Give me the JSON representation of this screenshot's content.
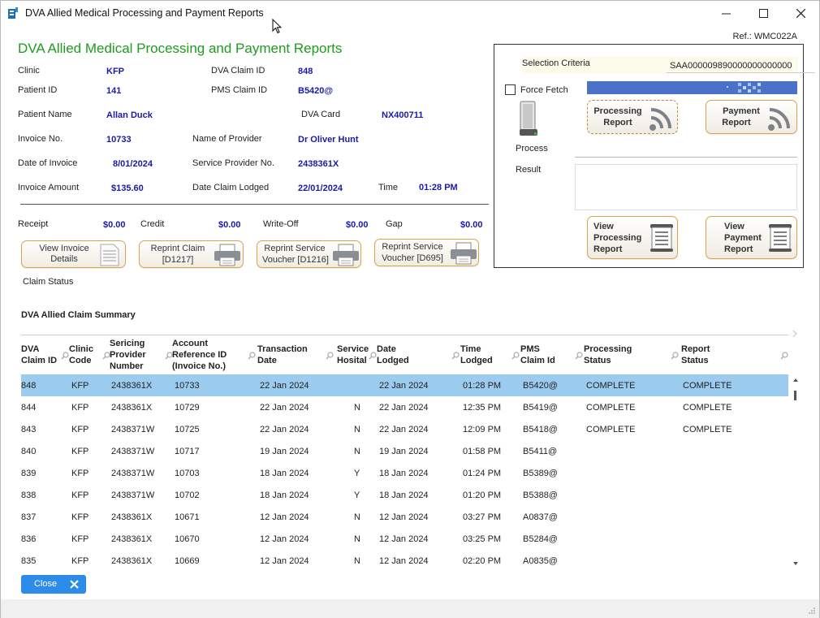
{
  "window": {
    "title": "DVA  Allied Medical Processing and Payment Reports"
  },
  "ref": "Ref.: WMC022A",
  "heading": "DVA  Allied Medical Processing and Payment Reports",
  "fields": {
    "clinic": {
      "label": "Clinic",
      "value": "KFP"
    },
    "dva_claim_id": {
      "label": "DVA Claim ID",
      "value": "848"
    },
    "patient_id": {
      "label": "Patient ID",
      "value": "141"
    },
    "pms_claim_id": {
      "label": "PMS Claim ID",
      "value": "B5420@"
    },
    "patient_name": {
      "label": "Patient Name",
      "value": "Allan  Duck"
    },
    "dva_card": {
      "label": "DVA Card",
      "value": "NX400711"
    },
    "invoice_no": {
      "label": "Invoice No.",
      "value": "10733"
    },
    "provider_name": {
      "label": "Name of Provider",
      "value": "Dr Oliver Hunt"
    },
    "invoice_date": {
      "label": "Date of Invoice",
      "value": "8/01/2024"
    },
    "service_provider_no": {
      "label": "Service Provider No.",
      "value": "2438361X"
    },
    "invoice_amount": {
      "label": "Invoice Amount",
      "value": "$135.60"
    },
    "date_claim_lodged": {
      "label": "Date Claim Lodged",
      "value": "22/01/2024"
    },
    "time": {
      "label": "Time",
      "value": "01:28 PM"
    }
  },
  "totals": {
    "receipt": {
      "label": "Receipt",
      "value": "$0.00"
    },
    "credit": {
      "label": "Credit",
      "value": "$0.00"
    },
    "writeoff": {
      "label": "Write-Off",
      "value": "$0.00"
    },
    "gap": {
      "label": "Gap",
      "value": "$0.00"
    }
  },
  "buttons": {
    "view_invoice": [
      "View Invoice",
      "Details"
    ],
    "reprint_claim": [
      "Reprint Claim",
      "[D1217]"
    ],
    "reprint_voucher_d1216": [
      "Reprint Service",
      "Voucher [D1216]"
    ],
    "reprint_voucher_d695": [
      "Reprint Service",
      "Voucher [D695]"
    ]
  },
  "claim_status_label": "Claim Status",
  "panel": {
    "selection_criteria_label": "Selection Criteria",
    "selection_criteria_value": "SAA000009890000000000000",
    "force_fetch_label": "Force Fetch",
    "force_fetch_checked": false,
    "process_label": "Process",
    "result_label": "Result",
    "processing_report": [
      "Processing",
      "Report"
    ],
    "payment_report": [
      "Payment",
      "Report"
    ],
    "view_processing_report": [
      "View",
      "Processing",
      "Report"
    ],
    "view_payment_report": [
      "View",
      "Payment",
      "Report"
    ]
  },
  "summary": {
    "title": "DVA  Allied Claim Summary",
    "columns": [
      [
        "DVA",
        "Claim ID"
      ],
      [
        "Clinic",
        "Code"
      ],
      [
        "Sericing",
        "Provider",
        "Number"
      ],
      [
        "Account",
        "Reference ID",
        "(Invoice No.)"
      ],
      [
        "Transaction",
        "Date"
      ],
      [
        "Service",
        "Hosital"
      ],
      [
        "Date",
        "Lodged"
      ],
      [
        "Time",
        "Lodged"
      ],
      [
        "PMS",
        "Claim Id"
      ],
      [
        "Processing",
        "Status"
      ],
      [
        "Report",
        "Status"
      ]
    ],
    "rows": [
      [
        "848",
        "KFP",
        "2438361X",
        "10733",
        "22 Jan 2024",
        "",
        "22 Jan 2024",
        "01:28 PM",
        "B5420@",
        "COMPLETE",
        "COMPLETE"
      ],
      [
        "844",
        "KFP",
        "2438361X",
        "10729",
        "22 Jan 2024",
        "N",
        "22 Jan 2024",
        "12:35 PM",
        "B5419@",
        "COMPLETE",
        "COMPLETE"
      ],
      [
        "843",
        "KFP",
        "2438371W",
        "10725",
        "22 Jan 2024",
        "N",
        "22 Jan 2024",
        "12:09 PM",
        "B5418@",
        "COMPLETE",
        "COMPLETE"
      ],
      [
        "840",
        "KFP",
        "2438371W",
        "10717",
        "19 Jan 2024",
        "N",
        "19 Jan 2024",
        "01:58 PM",
        "B5411@",
        "",
        ""
      ],
      [
        "839",
        "KFP",
        "2438371W",
        "10703",
        "18 Jan 2024",
        "Y",
        "18 Jan 2024",
        "01:24 PM",
        "B5389@",
        "",
        ""
      ],
      [
        "838",
        "KFP",
        "2438371W",
        "10702",
        "18 Jan 2024",
        "Y",
        "18 Jan 2024",
        "01:20 PM",
        "B5388@",
        "",
        ""
      ],
      [
        "837",
        "KFP",
        "2438361X",
        "10671",
        "12 Jan 2024",
        "N",
        "12 Jan 2024",
        "03:27 PM",
        "A0837@",
        "",
        ""
      ],
      [
        "836",
        "KFP",
        "2438361X",
        "10670",
        "12 Jan 2024",
        "N",
        "12 Jan 2024",
        "03:25 PM",
        "B5284@",
        "",
        ""
      ],
      [
        "835",
        "KFP",
        "2438361X",
        "10669",
        "12 Jan 2024",
        "N",
        "12 Jan 2024",
        "02:20 PM",
        "A0835@",
        "",
        ""
      ]
    ],
    "selected_row": 0
  },
  "close_button": "Close"
}
